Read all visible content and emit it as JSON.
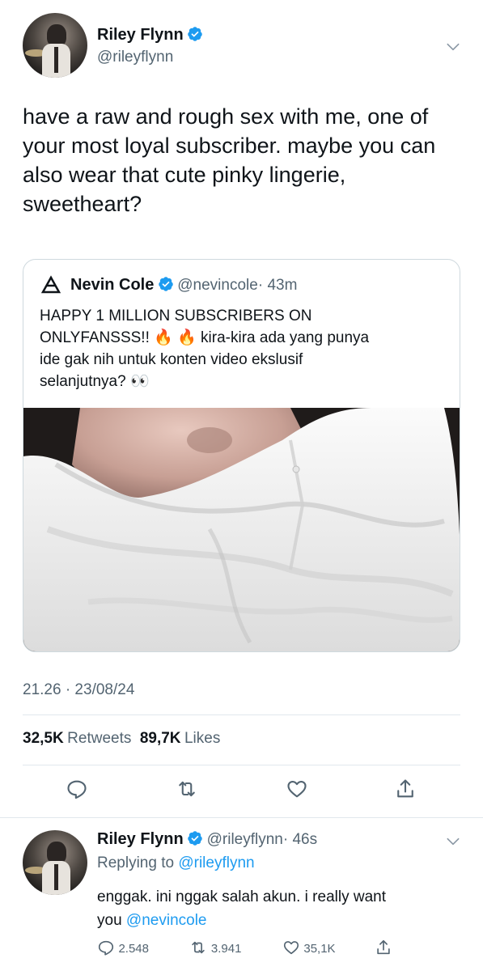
{
  "main_tweet": {
    "display_name": "Riley Flynn",
    "handle": "@rileyflynn",
    "text": "have a raw and rough sex with me, one of your most loyal subscriber. maybe you can also wear that cute pinky lingerie, sweetheart?",
    "timestamp": "21.26 · 23/08/24",
    "retweets_count": "32,5K",
    "retweets_label": "Retweets",
    "likes_count": "89,7K",
    "likes_label": "Likes"
  },
  "quoted_tweet": {
    "display_name": "Nevin Cole",
    "handle": "@nevincole",
    "time": "· 43m",
    "text_line1": "HAPPY 1 MILLION SUBSCRIBERS ON",
    "text_line2_a": "ONLYFANSSS!! ",
    "text_line2_b": " kira-kira ada yang punya",
    "text_line3": "ide gak nih untuk konten video ekslusif",
    "text_line4": "selanjutnya? ",
    "emoji_fire": "🔥",
    "emoji_eyes": "👀"
  },
  "reply": {
    "display_name": "Riley Flynn",
    "handle": "@rileyflynn",
    "time": "· 46s",
    "replying_prefix": "Replying to ",
    "replying_to": "@rileyflynn",
    "text_line1": "enggak. ini nggak salah akun. i really want",
    "text_line2": "you ",
    "mention": "@nevincole",
    "replies": "2.548",
    "retweets": "3.941",
    "likes": "35,1K"
  },
  "icons": {
    "verified": "verified-badge-icon",
    "chevron": "chevron-down-icon",
    "reply": "reply-icon",
    "retweet": "retweet-icon",
    "like": "heart-icon",
    "share": "share-icon",
    "author_logo": "nevin-cole-avatar-icon"
  },
  "colors": {
    "accent": "#1d9bf0",
    "text": "#0f1419",
    "muted": "#536471",
    "border": "#cfd9de"
  }
}
